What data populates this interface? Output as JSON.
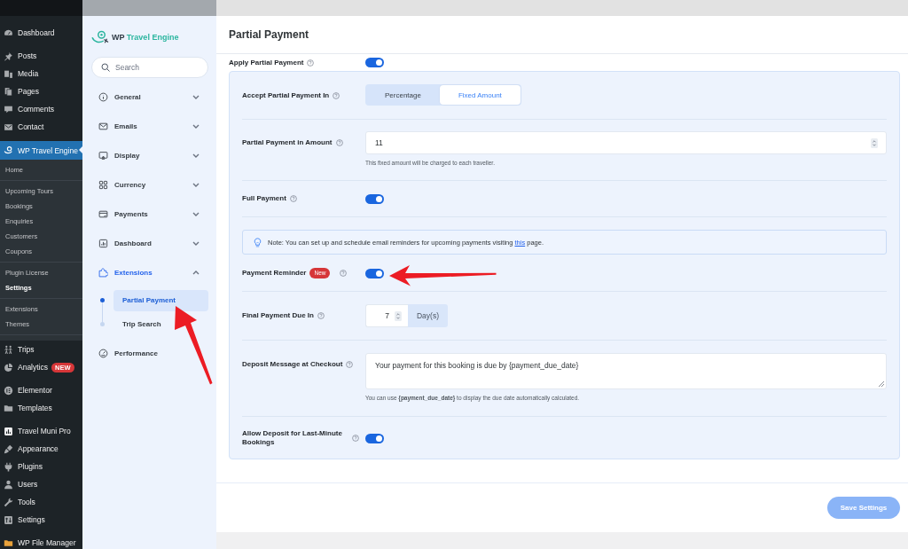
{
  "wp_menu": {
    "groups": [
      {
        "items": [
          {
            "label": "Dashboard",
            "selected": false
          }
        ]
      },
      {
        "items": [
          {
            "label": "Posts",
            "selected": false
          },
          {
            "label": "Media",
            "selected": false
          },
          {
            "label": "Pages",
            "selected": false
          },
          {
            "label": "Comments",
            "selected": false
          },
          {
            "label": "Contact",
            "selected": false
          }
        ]
      },
      {
        "items": [
          {
            "label": "WP Travel Engine",
            "selected": true,
            "submenu": [
              {
                "items": [
                  {
                    "label": "Home",
                    "selected": false
                  }
                ]
              },
              {
                "items": [
                  {
                    "label": "Upcoming Tours",
                    "selected": false
                  },
                  {
                    "label": "Bookings",
                    "selected": false
                  },
                  {
                    "label": "Enquiries",
                    "selected": false
                  },
                  {
                    "label": "Customers",
                    "selected": false
                  },
                  {
                    "label": "Coupons",
                    "selected": false
                  }
                ]
              },
              {
                "items": [
                  {
                    "label": "Plugin License",
                    "selected": false
                  },
                  {
                    "label": "Settings",
                    "selected": true
                  }
                ]
              },
              {
                "items": [
                  {
                    "label": "Extensions",
                    "selected": false
                  },
                  {
                    "label": "Themes",
                    "selected": false
                  }
                ]
              }
            ]
          }
        ]
      },
      {
        "items": [
          {
            "label": "Trips",
            "selected": false
          },
          {
            "label": "Analytics",
            "selected": false,
            "badge": "NEW"
          }
        ]
      },
      {
        "items": [
          {
            "label": "Elementor",
            "selected": false
          },
          {
            "label": "Templates",
            "selected": false
          }
        ]
      },
      {
        "items": [
          {
            "label": "Travel Muni Pro",
            "selected": false
          },
          {
            "label": "Appearance",
            "selected": false
          },
          {
            "label": "Plugins",
            "selected": false
          },
          {
            "label": "Users",
            "selected": false
          },
          {
            "label": "Tools",
            "selected": false
          },
          {
            "label": "Settings",
            "selected": false
          }
        ]
      },
      {
        "items": [
          {
            "label": "WP File Manager",
            "selected": false
          }
        ]
      }
    ]
  },
  "plugin_sidebar": {
    "logo": {
      "prefix": "WP",
      "name": "Travel Engine"
    },
    "search": {
      "placeholder": "Search"
    },
    "items": [
      {
        "label": "General",
        "kind": "group",
        "expanded": false,
        "selected": false
      },
      {
        "label": "Emails",
        "kind": "group",
        "expanded": false,
        "selected": false
      },
      {
        "label": "Display",
        "kind": "group",
        "expanded": false,
        "selected": false
      },
      {
        "label": "Currency",
        "kind": "group",
        "expanded": false,
        "selected": false
      },
      {
        "label": "Payments",
        "kind": "group",
        "expanded": false,
        "selected": false
      },
      {
        "label": "Dashboard",
        "kind": "group",
        "expanded": false,
        "selected": false
      },
      {
        "label": "Extensions",
        "kind": "group",
        "expanded": true,
        "selected": true,
        "children": [
          {
            "label": "Partial Payment",
            "selected": true
          },
          {
            "label": "Trip Search",
            "selected": false
          }
        ]
      },
      {
        "label": "Performance",
        "kind": "link",
        "selected": false
      }
    ]
  },
  "page": {
    "title": "Partial Payment",
    "apply_partial_payment": {
      "label": "Apply Partial Payment",
      "on": true
    },
    "fields": [
      {
        "kind": "segmented",
        "label": "Accept Partial Payment In",
        "options": [
          {
            "label": "Percentage",
            "selected": false
          },
          {
            "label": "Fixed Amount",
            "selected": true
          }
        ]
      },
      {
        "kind": "number",
        "label": "Partial Payment in Amount",
        "value": "11",
        "hint": "This fixed amount will be charged to each traveller."
      },
      {
        "kind": "toggle",
        "label": "Full Payment",
        "on": true
      },
      {
        "kind": "note",
        "text": "Note: You can set up and schedule email reminders for upcoming payments visiting",
        "link": "this",
        "after": "page."
      },
      {
        "kind": "toggle",
        "label": "Payment Reminder",
        "badge": "New",
        "on": true
      },
      {
        "kind": "number_unit",
        "label": "Final Payment Due In",
        "value": "7",
        "unit": "Day(s)"
      },
      {
        "kind": "textarea",
        "label": "Deposit Message at Checkout",
        "value": "Your payment for this booking is due by {payment_due_date}",
        "hint": "You can use **{payment_due_date}** to display the due date automatically calculated."
      },
      {
        "kind": "toggle",
        "label": "Allow Deposit for Last-Minute Bookings",
        "on": true
      }
    ],
    "save_button": "Save Settings"
  }
}
